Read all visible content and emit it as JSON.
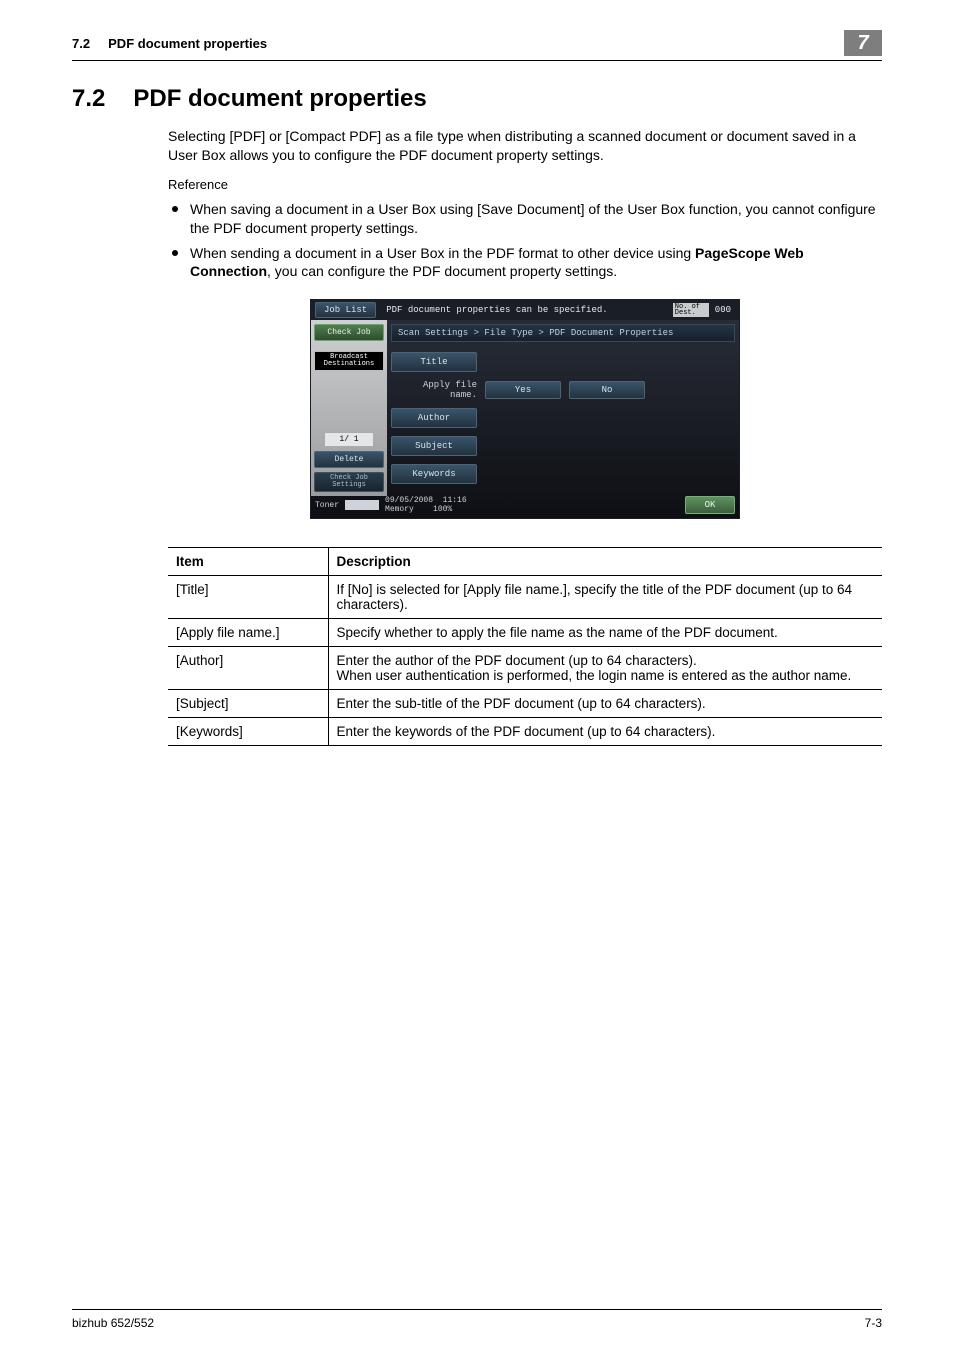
{
  "header": {
    "section_num": "7.2",
    "section_title": "PDF document properties",
    "chapter_num": "7"
  },
  "heading": {
    "num": "7.2",
    "title": "PDF document properties"
  },
  "intro_para": "Selecting [PDF] or [Compact PDF] as a file type when distributing a scanned document or document saved in a User Box allows you to configure the PDF document property settings.",
  "reference_label": "Reference",
  "bullets": {
    "b1": "When saving a document in a User Box using [Save Document] of the User Box function, you cannot configure the PDF document property settings.",
    "b2_pre": "When sending a document in a User Box in the PDF format to other device using ",
    "b2_bold": "PageScope Web Connection",
    "b2_post": ", you can configure the PDF document property settings."
  },
  "panel": {
    "job_list": "Job List",
    "top_msg": "PDF document properties can be specified.",
    "dest_label": "No. of\nDest.",
    "dest_count": "000",
    "check_job": "Check Job",
    "broadcast": "Broadcast\nDestinations",
    "pager": "1/  1",
    "delete": "Delete",
    "check_settings": "Check Job\nSettings",
    "crumb": "Scan Settings > File Type > PDF Document Properties",
    "title_btn": "Title",
    "apply_label": "Apply file name.",
    "yes": "Yes",
    "no": "No",
    "author_btn": "Author",
    "subject_btn": "Subject",
    "keywords_btn": "Keywords",
    "toner": "Toner",
    "date": "09/05/2008",
    "time": "11:16",
    "memory": "Memory",
    "mem_pct": "100%",
    "ok": "OK"
  },
  "table": {
    "h_item": "Item",
    "h_desc": "Description",
    "r1_item": "[Title]",
    "r1_desc": "If [No] is selected for [Apply file name.], specify the title of the PDF document (up to 64 characters).",
    "r2_item": "[Apply file name.]",
    "r2_desc": "Specify whether to apply the file name as the name of the PDF document.",
    "r3_item": "[Author]",
    "r3_desc": "Enter the author of the PDF document (up to 64 characters).\nWhen user authentication is performed, the login name is entered as the author name.",
    "r4_item": "[Subject]",
    "r4_desc": "Enter the sub-title of the PDF document (up to 64 characters).",
    "r5_item": "[Keywords]",
    "r5_desc": "Enter the keywords of the PDF document (up to 64 characters)."
  },
  "footer": {
    "left": "bizhub 652/552",
    "right": "7-3"
  }
}
